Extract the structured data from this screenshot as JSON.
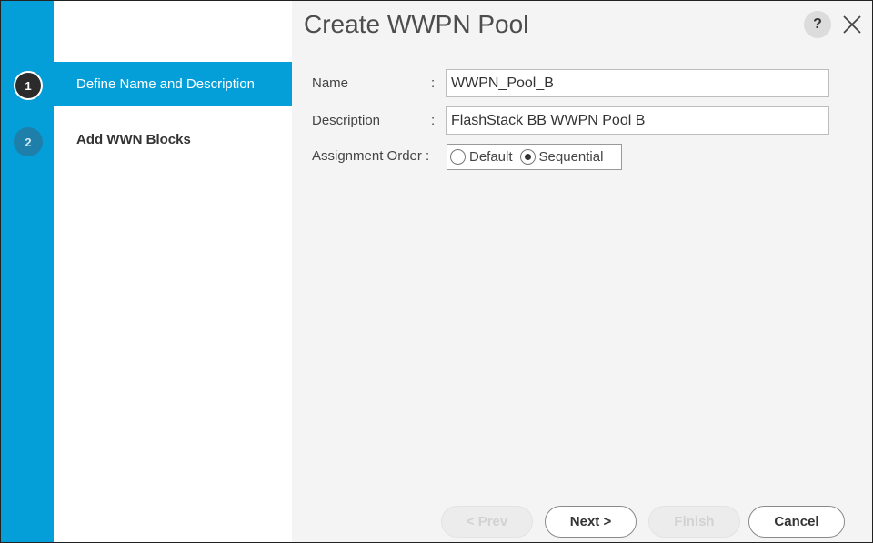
{
  "wizard": {
    "title": "Create WWPN Pool",
    "help_label": "?",
    "close_icon": "close-icon",
    "steps": [
      {
        "number": "1",
        "label": "Define Name and Description",
        "active": true
      },
      {
        "number": "2",
        "label": "Add WWN Blocks",
        "active": false
      }
    ]
  },
  "form": {
    "name": {
      "label": "Name",
      "colon": ":",
      "value": "WWPN_Pool_B"
    },
    "description": {
      "label": "Description",
      "colon": ":",
      "value": "FlashStack BB WWPN Pool B"
    },
    "assignment_order": {
      "label": "Assignment Order :",
      "options": [
        {
          "label": "Default",
          "checked": false
        },
        {
          "label": "Sequential",
          "checked": true
        }
      ]
    }
  },
  "footer": {
    "prev_label": "< Prev",
    "next_label": "Next >",
    "finish_label": "Finish",
    "cancel_label": "Cancel"
  },
  "colors": {
    "accent": "#049fd9",
    "active_step_circle": "#2b2b2b",
    "content_bg": "#f4f4f4"
  }
}
